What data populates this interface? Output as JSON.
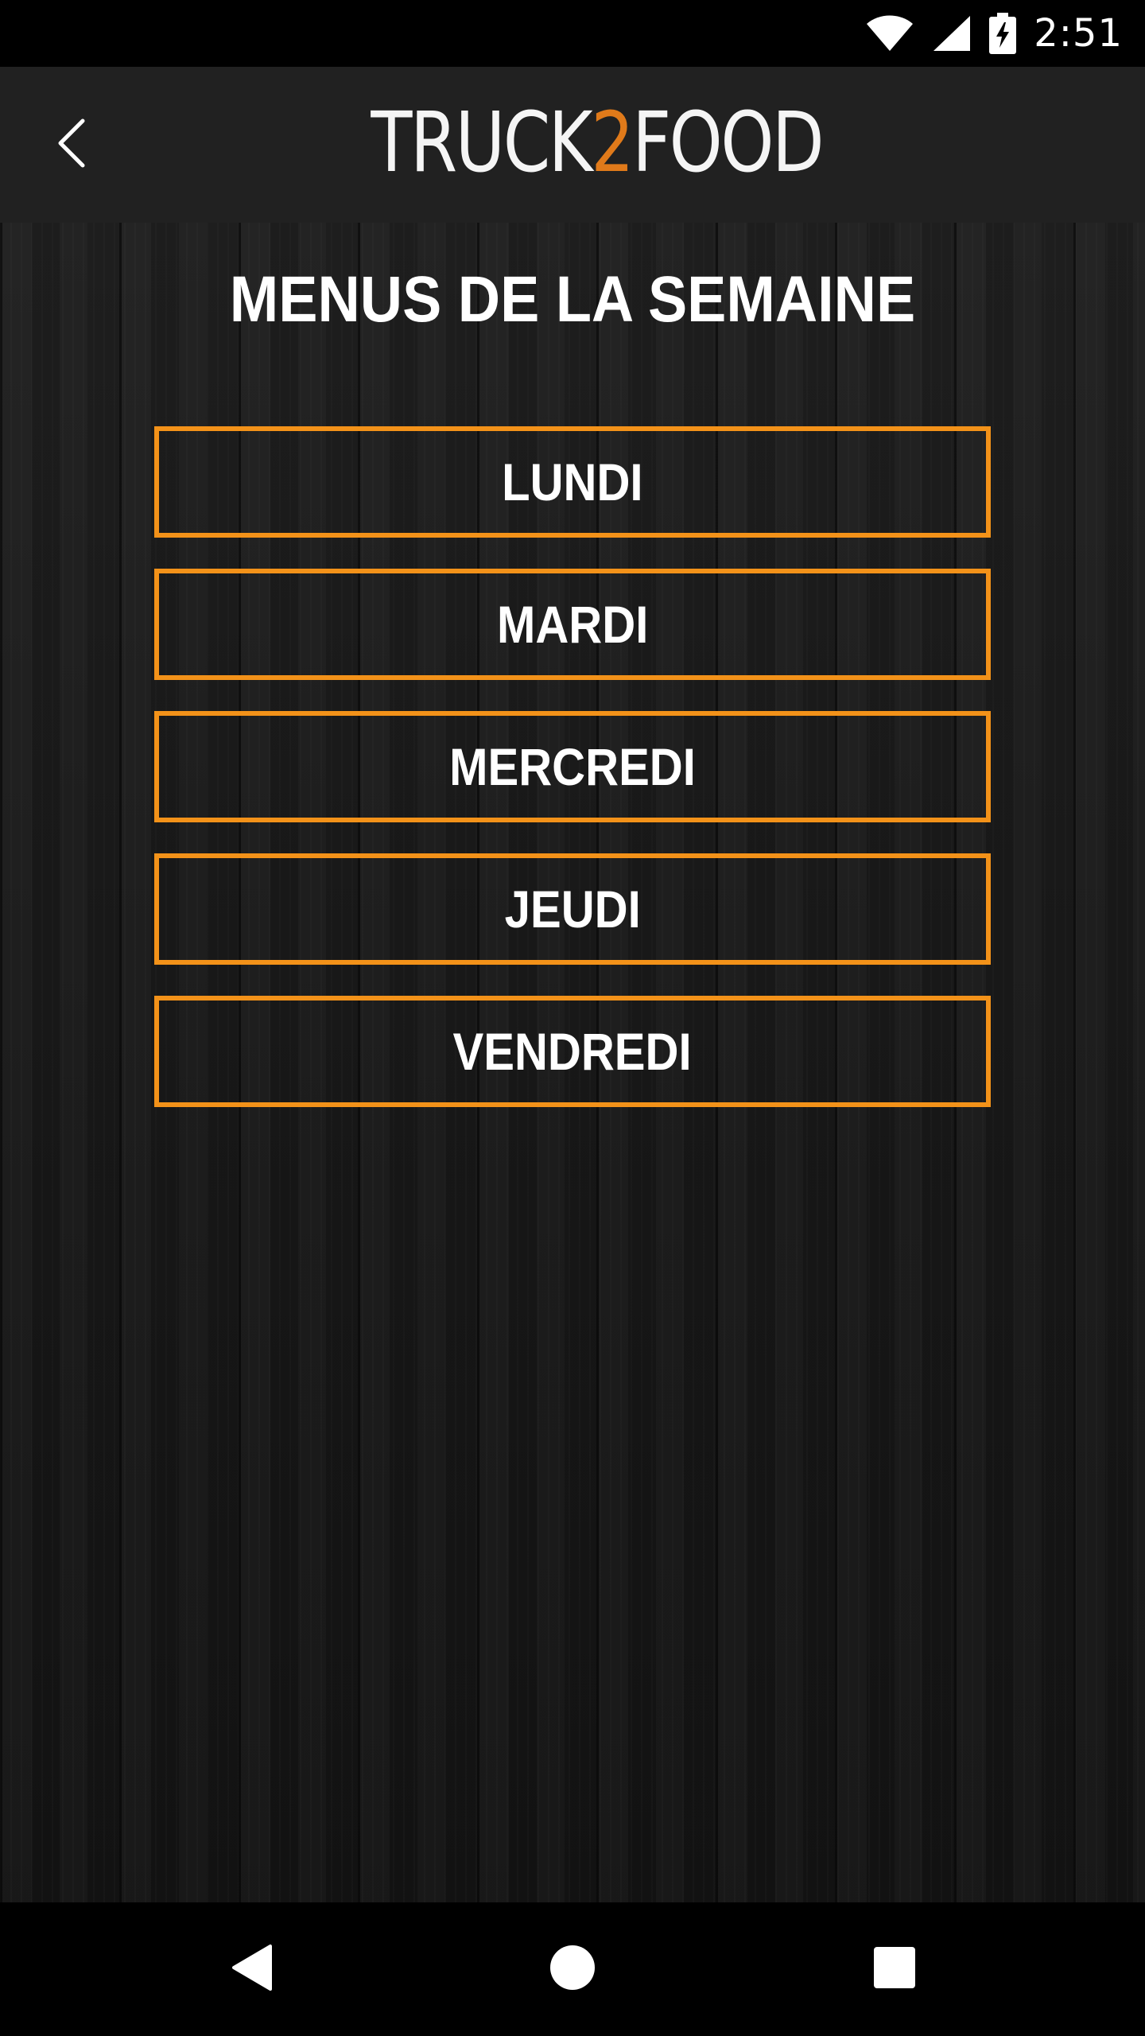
{
  "status_bar": {
    "time": "2:51",
    "icons": [
      "wifi-icon",
      "cellular-signal-icon",
      "battery-charging-icon"
    ]
  },
  "app_bar": {
    "back_icon": "chevron-left-icon",
    "logo": {
      "part1": "TRUCK",
      "part2": "2",
      "part3": "FOOD",
      "accent_color": "#e07a1a"
    }
  },
  "main": {
    "title": "MENUS DE LA SEMAINE",
    "accent_color": "#f39219",
    "days": [
      {
        "label": "LUNDI"
      },
      {
        "label": "MARDI"
      },
      {
        "label": "MERCREDI"
      },
      {
        "label": "JEUDI"
      },
      {
        "label": "VENDREDI"
      }
    ]
  },
  "nav_bar": {
    "icons": [
      "nav-back-icon",
      "nav-home-icon",
      "nav-recents-icon"
    ]
  }
}
